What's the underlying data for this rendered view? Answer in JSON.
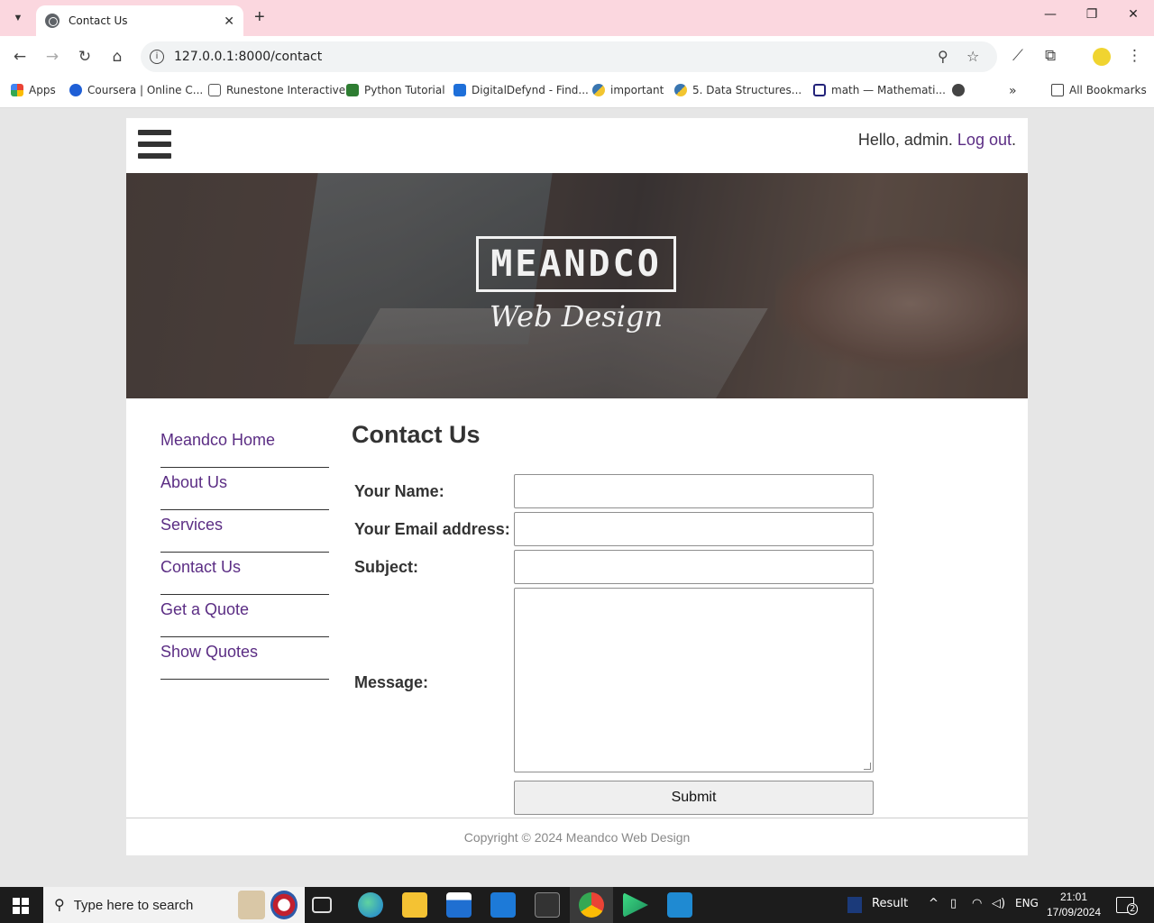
{
  "browser": {
    "tab_title": "Contact Us",
    "url": "127.0.0.1:8000/contact",
    "bookmarks": [
      "Apps",
      "Coursera | Online C...",
      "Runestone Interactive",
      "Python Tutorial",
      "DigitalDefynd - Find...",
      "important",
      "5. Data Structures...",
      "math — Mathemati..."
    ],
    "all_bookmarks": "All Bookmarks"
  },
  "site": {
    "greeting_prefix": "Hello, admin. ",
    "logout_label": "Log out",
    "greeting_suffix": ".",
    "logo_text": "MEANDCO",
    "logo_subtext": "Web Design",
    "nav": [
      "Meandco Home",
      "About Us",
      "Services",
      "Contact Us",
      "Get a Quote",
      "Show Quotes"
    ],
    "page_title": "Contact Us",
    "form": {
      "name_label": "Your Name:",
      "name_value": "",
      "email_label": "Your Email address:",
      "email_value": "",
      "subject_label": "Subject:",
      "subject_value": "",
      "message_label": "Message:",
      "message_value": "",
      "submit_label": "Submit"
    },
    "footer": "Copyright © 2024 Meandco Web Design"
  },
  "taskbar": {
    "search_placeholder": "Type here to search",
    "result_label": "Result",
    "lang": "ENG",
    "time": "21:01",
    "date": "17/09/2024",
    "notifications": "2"
  },
  "colors": {
    "link": "#5b2d84",
    "tabbar": "#fbd7df",
    "accent_profile": "#f0d430"
  }
}
